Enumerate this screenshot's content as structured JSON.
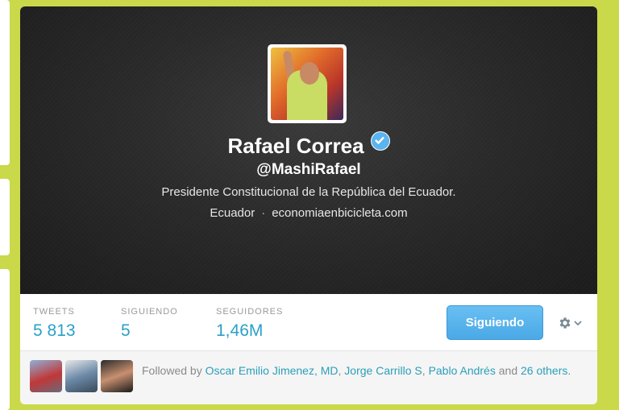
{
  "profile": {
    "name": "Rafael Correa",
    "handle": "@MashiRafael",
    "bio": "Presidente Constitucional de la República del Ecuador.",
    "location": "Ecuador",
    "separator": "·",
    "website": "economiaenbicicleta.com",
    "verified_icon": "verified-badge-icon",
    "accent_color": "#2aa0c8"
  },
  "stats": [
    {
      "label": "TWEETS",
      "value": "5 813"
    },
    {
      "label": "SIGUIENDO",
      "value": "5"
    },
    {
      "label": "SEGUIDORES",
      "value": "1,46M"
    }
  ],
  "actions": {
    "follow_label": "Siguiendo",
    "settings_icon": "gear-icon",
    "dropdown_icon": "chevron-down-icon"
  },
  "followed_by": {
    "prefix": "Followed by",
    "users": [
      "Oscar Emilio Jimenez, MD",
      "Jorge Carrillo S",
      "Pablo Andrés"
    ],
    "and_text": "and",
    "others": "26 others."
  }
}
